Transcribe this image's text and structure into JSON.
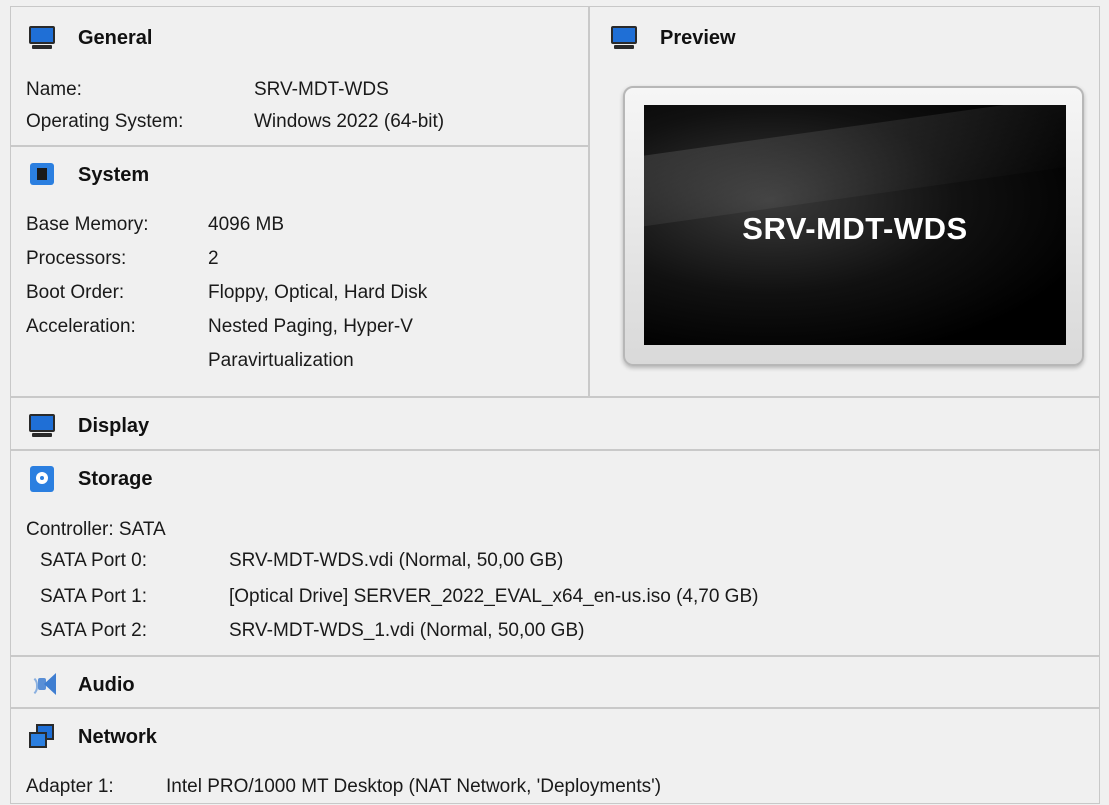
{
  "general": {
    "title": "General",
    "name_label": "Name:",
    "name_value": "SRV-MDT-WDS",
    "os_label": "Operating System:",
    "os_value": "Windows 2022 (64-bit)"
  },
  "system": {
    "title": "System",
    "memory_label": "Base Memory:",
    "memory_value": "4096 MB",
    "processors_label": "Processors:",
    "processors_value": "2",
    "boot_label": "Boot Order:",
    "boot_value": "Floppy, Optical, Hard Disk",
    "accel_label": "Acceleration:",
    "accel_value_1": "Nested Paging, Hyper-V",
    "accel_value_2": "Paravirtualization"
  },
  "preview": {
    "title": "Preview",
    "screen_text": "SRV-MDT-WDS"
  },
  "display": {
    "title": "Display"
  },
  "storage": {
    "title": "Storage",
    "controller": "Controller: SATA",
    "ports": [
      {
        "label": "SATA Port 0:",
        "value": "SRV-MDT-WDS.vdi (Normal, 50,00 GB)"
      },
      {
        "label": "SATA Port 1:",
        "value": "[Optical Drive] SERVER_2022_EVAL_x64_en-us.iso (4,70 GB)"
      },
      {
        "label": "SATA Port 2:",
        "value": "SRV-MDT-WDS_1.vdi (Normal, 50,00 GB)"
      }
    ]
  },
  "audio": {
    "title": "Audio"
  },
  "network": {
    "title": "Network",
    "adapter_label": "Adapter 1:",
    "adapter_value": "Intel PRO/1000 MT Desktop (NAT Network, 'Deployments')"
  },
  "colors": {
    "accent": "#1f6fd6",
    "background": "#f0f0f0",
    "separator": "#c9c9c9"
  },
  "icons": [
    "monitor-icon",
    "chip-icon",
    "disk-icon",
    "speaker-icon",
    "network-icon"
  ]
}
